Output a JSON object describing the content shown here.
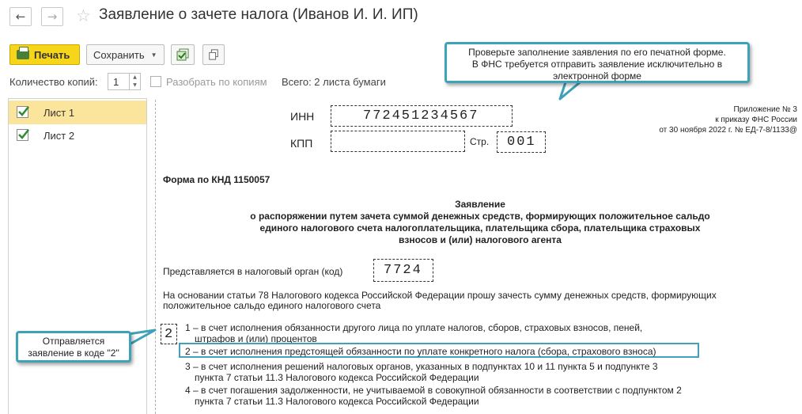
{
  "window": {
    "back_icon": "←",
    "forward_icon": "→",
    "star_icon": "☆",
    "title": "Заявление о зачете налога (Иванов И. И. ИП)"
  },
  "toolbar": {
    "print_label": "Печать",
    "save_label": "Сохранить",
    "save_chevron": "▼",
    "copies_label": "Количество копий:",
    "copies_value": "1",
    "spin_up": "▲",
    "spin_down": "▼",
    "collate_label": "Разобрать по копиям",
    "total_label": "Всего: 2 листа бумаги"
  },
  "sheets": [
    {
      "label": "Лист 1",
      "checked": true,
      "selected": true
    },
    {
      "label": "Лист 2",
      "checked": true,
      "selected": false
    }
  ],
  "callouts": {
    "top": {
      "line1": "Проверьте заполнение заявления по его печатной форме.",
      "line2": "В ФНС требуется отправить заявление исключительно в",
      "line3": "электронной форме"
    },
    "left": {
      "line1": "Отправляется",
      "line2": "заявление в коде \"2\""
    }
  },
  "document": {
    "inn_label": "ИНН",
    "inn_value": "772451234567",
    "kpp_label": "КПП",
    "kpp_value": "",
    "page_label": "Стр.",
    "page_value": "001",
    "appendix_line1": "Приложение № 3",
    "appendix_line2": "к приказу ФНС России",
    "appendix_line3": "от 30 ноября 2022 г. №  ЕД-7-8/1133@",
    "form_code": "Форма по КНД 1150057",
    "heading": "Заявление",
    "subheading_line1": "о распоряжении путем зачета суммой денежных средств, формирующих положительное сальдо",
    "subheading_line2": "единого налогового счета налогоплательщика, плательщика сбора, плательщика страховых",
    "subheading_line3": "взносов и (или) налогового агента",
    "authority_label": "Представляется в налоговый орган (код)",
    "authority_code": "7724",
    "basis_line1": "На основании статьи 78 Налогового кодекса Российской Федерации прошу зачесть сумму денежных средств, формирующих",
    "basis_line2": "положительное сальдо единого налогового счета",
    "selected_code": "2",
    "option1_line1": "1 – в счет исполнения обязанности другого лица по уплате налогов, сборов, страховых взносов, пеней,",
    "option1_line2": "штрафов и (или) процентов",
    "option2_line1": "2 – в счет исполнения предстоящей обязанности по уплате конкретного налога (сбора, страхового взноса)",
    "option3_line1": "3 – в счет исполнения решений налоговых органов, указанных в подпунктах 10 и 11 пункта 5 и подпункте 3",
    "option3_line2": "пункта 7 статьи 11.3 Налогового кодекса Российской Федерации",
    "option4_line1": "4 – в счет погашения задолженности, не учитываемой в совокупной обязанности в соответствии с подпунктом 2",
    "option4_line2": "пункта 7 статьи 11.3 Налогового кодекса Российской Федерации"
  },
  "colors": {
    "accent": "#3fa2b8",
    "print_button": "#f7d51b",
    "selected_row": "#fbe59c"
  }
}
